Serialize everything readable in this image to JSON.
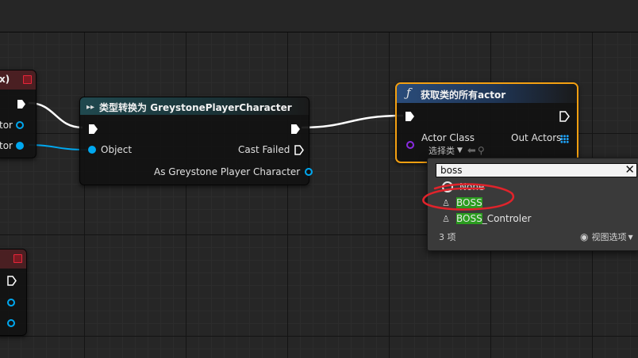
{
  "left_nodes": {
    "top_node": {
      "title_fragment": "x)",
      "pin1_label": "tor",
      "pin2_label": "tor"
    }
  },
  "cast_node": {
    "title": "类型转换为 GreystonePlayerCharacter",
    "object_pin": "Object",
    "cast_failed_pin": "Cast Failed",
    "as_pin": "As Greystone Player Character"
  },
  "get_actors_node": {
    "title": "获取类的所有actor",
    "actor_class_pin": "Actor Class",
    "out_actors_pin": "Out Actors",
    "class_select_label": "选择类"
  },
  "class_picker": {
    "search_value": "boss",
    "items": [
      {
        "label": "None",
        "highlight": "",
        "rest": "None"
      },
      {
        "label": "BOSS",
        "highlight": "BOSS",
        "rest": ""
      },
      {
        "label": "BOSS_Controler",
        "highlight": "BOSS",
        "rest": "_Controler"
      }
    ],
    "count_label": "3 项",
    "view_options_label": "视图选项"
  },
  "colors": {
    "exec": "#ffffff",
    "object_pin": "#00a8f0",
    "class_pin": "#8a2be2",
    "cast_header": "#20494f",
    "function_header": "#2a4c7a",
    "selection_border": "#f4a011",
    "search_highlight": "#2a9c1e",
    "annotation": "#e0232b"
  }
}
